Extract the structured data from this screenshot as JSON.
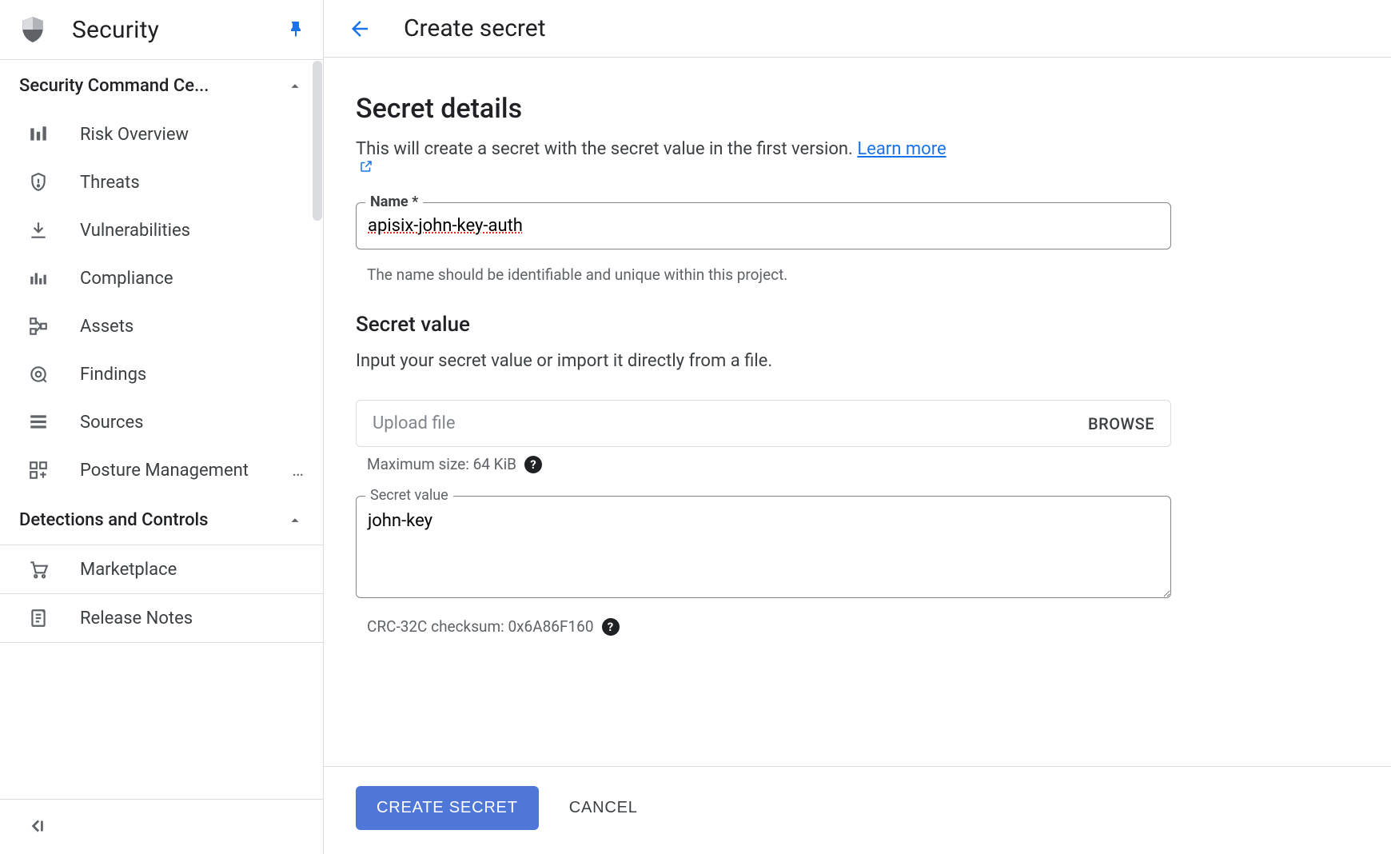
{
  "sidebar": {
    "title": "Security",
    "sections": [
      {
        "label": "Security Command Ce...",
        "expanded": true,
        "items": [
          {
            "icon": "dashboard-icon",
            "label": "Risk Overview"
          },
          {
            "icon": "threat-icon",
            "label": "Threats"
          },
          {
            "icon": "vuln-icon",
            "label": "Vulnerabilities"
          },
          {
            "icon": "compliance-icon",
            "label": "Compliance"
          },
          {
            "icon": "assets-icon",
            "label": "Assets"
          },
          {
            "icon": "findings-icon",
            "label": "Findings"
          },
          {
            "icon": "sources-icon",
            "label": "Sources"
          },
          {
            "icon": "posture-icon",
            "label": "Posture Management",
            "overflow": "…"
          }
        ]
      },
      {
        "label": "Detections and Controls",
        "expanded": true,
        "items": []
      }
    ],
    "footer_items": [
      {
        "icon": "marketplace-icon",
        "label": "Marketplace"
      },
      {
        "icon": "release-notes-icon",
        "label": "Release Notes"
      }
    ]
  },
  "page": {
    "title": "Create secret"
  },
  "form": {
    "section_title": "Secret details",
    "section_desc": "This will create a secret with the secret value in the first version.",
    "learn_more": "Learn more",
    "name_label": "Name *",
    "name_value": "apisix-john-key-auth",
    "name_helper": "The name should be identifiable and unique within this project.",
    "value_heading": "Secret value",
    "value_desc": "Input your secret value or import it directly from a file.",
    "upload_placeholder": "Upload file",
    "browse_label": "BROWSE",
    "max_size": "Maximum size: 64 KiB",
    "secret_label": "Secret value",
    "secret_value": "john-key",
    "checksum": "CRC-32C checksum: 0x6A86F160"
  },
  "actions": {
    "primary": "CREATE SECRET",
    "cancel": "CANCEL"
  }
}
